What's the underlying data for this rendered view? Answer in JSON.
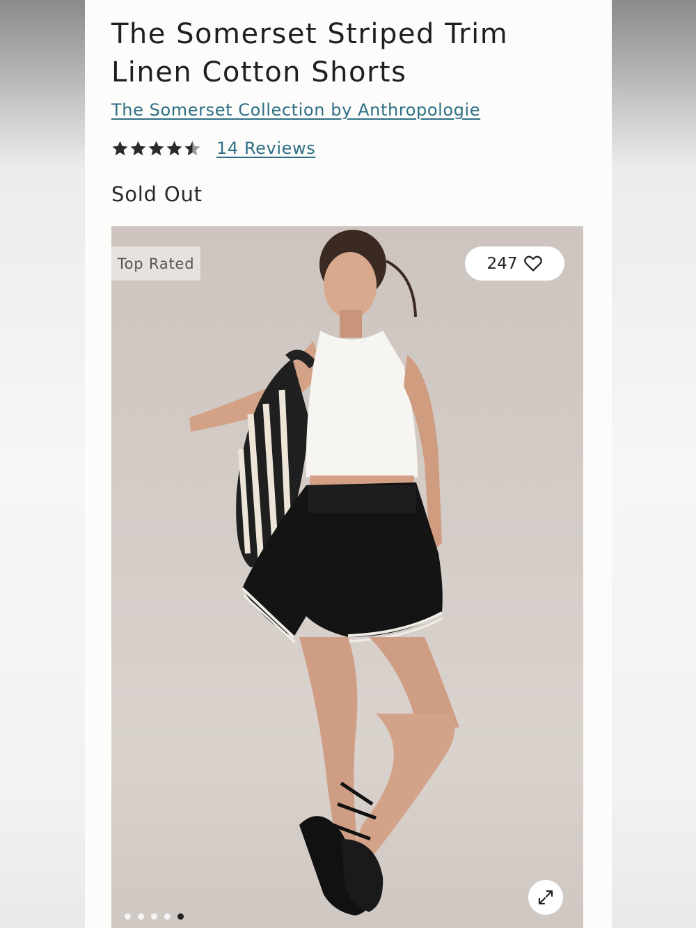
{
  "product": {
    "title_line1": "The Somerset Striped Trim",
    "title_line2": "Linen Cotton Shorts",
    "brand_link": "The Somerset Collection by Anthropologie",
    "rating": 4.5,
    "rating_max": 5,
    "reviews_link": "14 Reviews",
    "status": "Sold Out"
  },
  "gallery": {
    "badge": "Top Rated",
    "likes": "247",
    "slide_count": 5,
    "active_slide": 5,
    "icons": {
      "heart": "heart-icon",
      "expand": "expand-icon",
      "star": "star-icon"
    }
  },
  "colors": {
    "link": "#2e6f85",
    "text": "#1f1f1f",
    "page_bg": "#fcfcfa",
    "image_bg": "#d4ccc7"
  }
}
